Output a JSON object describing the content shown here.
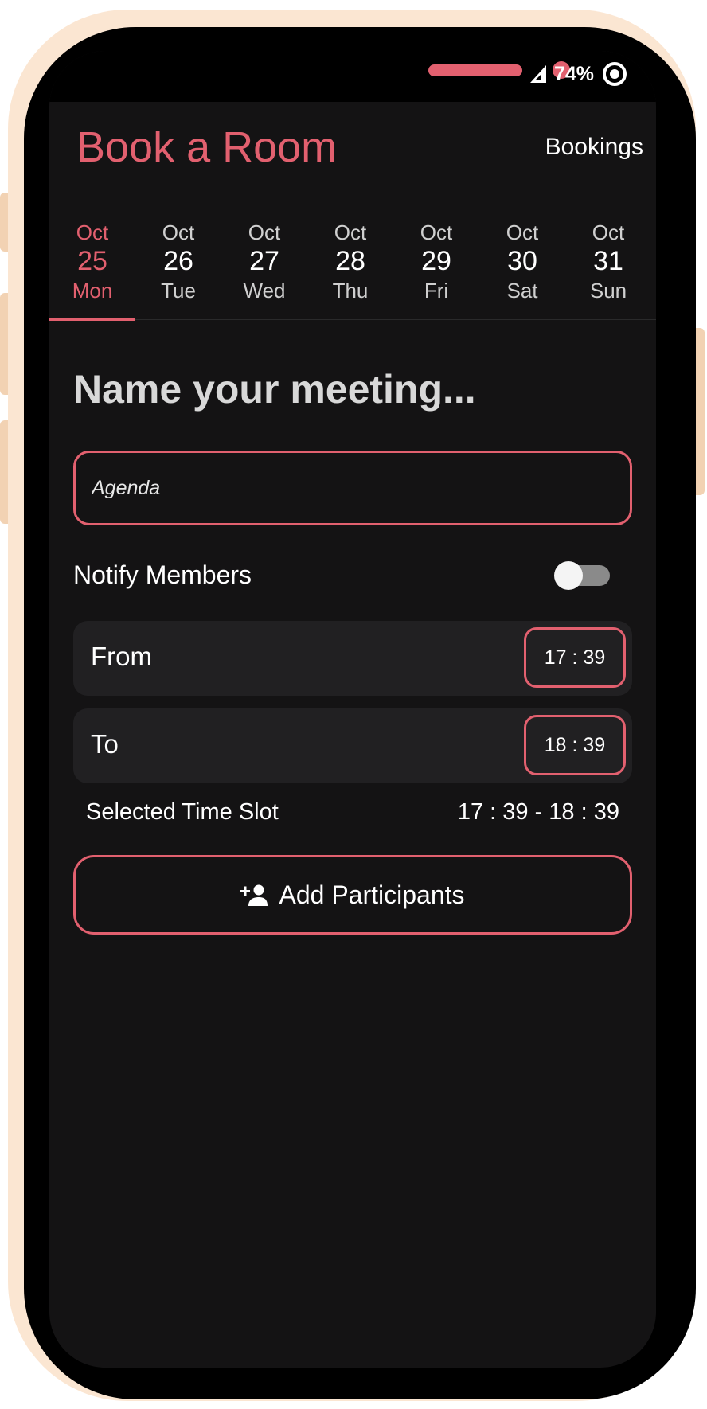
{
  "status_bar": {
    "battery": "74%",
    "icons": [
      "signal-icon",
      "battery-icon"
    ]
  },
  "header": {
    "title": "Book a Room",
    "bookings_link": "Bookings"
  },
  "dates": [
    {
      "month": "Oct",
      "day": "25",
      "weekday": "Mon",
      "selected": true
    },
    {
      "month": "Oct",
      "day": "26",
      "weekday": "Tue",
      "selected": false
    },
    {
      "month": "Oct",
      "day": "27",
      "weekday": "Wed",
      "selected": false
    },
    {
      "month": "Oct",
      "day": "28",
      "weekday": "Thu",
      "selected": false
    },
    {
      "month": "Oct",
      "day": "29",
      "weekday": "Fri",
      "selected": false
    },
    {
      "month": "Oct",
      "day": "30",
      "weekday": "Sat",
      "selected": false
    },
    {
      "month": "Oct",
      "day": "31",
      "weekday": "Sun",
      "selected": false
    }
  ],
  "meeting": {
    "heading": "Name your meeting...",
    "agenda_placeholder": "Agenda",
    "agenda_value": ""
  },
  "notify": {
    "label": "Notify Members",
    "enabled": false
  },
  "time": {
    "from_label": "From",
    "from_value": "17 : 39",
    "to_label": "To",
    "to_value": "18 : 39",
    "slot_label": "Selected Time Slot",
    "slot_value": "17 : 39 - 18 : 39"
  },
  "actions": {
    "add_participants": "Add Participants",
    "add_icon": "person-add-icon"
  },
  "colors": {
    "accent": "#e2606f",
    "background": "#141314",
    "row_background": "#212022",
    "frame": "#fbe6d2"
  }
}
